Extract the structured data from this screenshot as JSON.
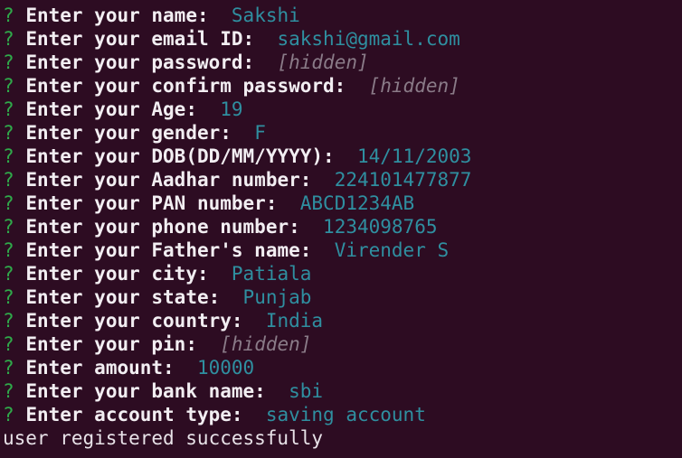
{
  "terminal": {
    "background_color": "#2d0c22",
    "prompt_symbol": "?",
    "prompt_color": "#2faa4a",
    "label_color": "#f2eef2",
    "value_color": "#2f8fa0",
    "hidden_value_color": "#8a7b88",
    "status_color": "#e8e2e8",
    "hidden_placeholder": "[hidden]",
    "prompts": [
      {
        "label": "Enter your name:",
        "value": "Sakshi",
        "hidden": false
      },
      {
        "label": "Enter your email ID:",
        "value": "sakshi@gmail.com",
        "hidden": false
      },
      {
        "label": "Enter your password:",
        "value": "[hidden]",
        "hidden": true
      },
      {
        "label": "Enter your confirm password:",
        "value": "[hidden]",
        "hidden": true
      },
      {
        "label": "Enter your Age:",
        "value": "19",
        "hidden": false
      },
      {
        "label": "Enter your gender:",
        "value": "F",
        "hidden": false
      },
      {
        "label": "Enter your DOB(DD/MM/YYYY):",
        "value": "14/11/2003",
        "hidden": false
      },
      {
        "label": "Enter your Aadhar number:",
        "value": "224101477877",
        "hidden": false
      },
      {
        "label": "Enter your PAN number:",
        "value": "ABCD1234AB",
        "hidden": false
      },
      {
        "label": "Enter your phone number:",
        "value": "1234098765",
        "hidden": false
      },
      {
        "label": "Enter your Father's name:",
        "value": "Virender S",
        "hidden": false
      },
      {
        "label": "Enter your city:",
        "value": "Patiala",
        "hidden": false
      },
      {
        "label": "Enter your state:",
        "value": "Punjab",
        "hidden": false
      },
      {
        "label": "Enter your country:",
        "value": "India",
        "hidden": false
      },
      {
        "label": "Enter your pin:",
        "value": "[hidden]",
        "hidden": true
      },
      {
        "label": "Enter amount:",
        "value": "10000",
        "hidden": false
      },
      {
        "label": "Enter your bank name:",
        "value": "sbi",
        "hidden": false
      },
      {
        "label": "Enter account type:",
        "value": "saving account",
        "hidden": false
      }
    ],
    "status_message": "user registered successfully"
  }
}
